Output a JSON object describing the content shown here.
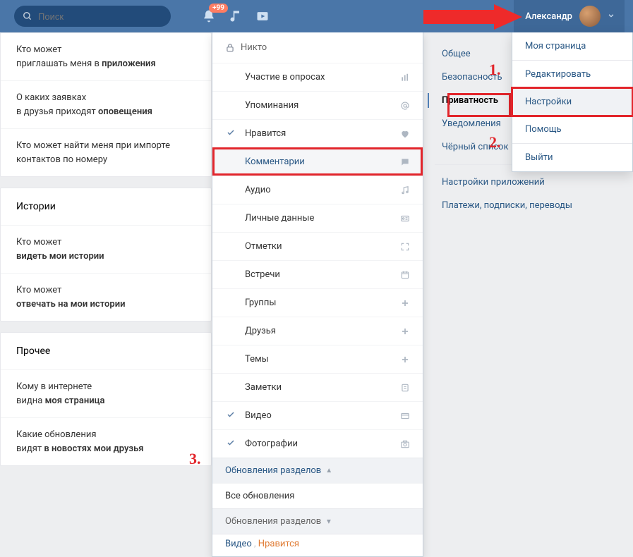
{
  "topbar": {
    "search_placeholder": "Поиск",
    "bell_badge": "+99",
    "user_name": "Александр"
  },
  "left": {
    "group1": [
      {
        "line1": "Кто может",
        "line2_a": "приглашать меня в ",
        "line2_b": "приложения"
      },
      {
        "line1": "О каких заявках",
        "line2_a": "в друзья приходят ",
        "line2_b": "оповещения"
      },
      {
        "line1": "Кто может найти меня при импорте",
        "line2_a": "контактов по номеру",
        "line2_b": ""
      }
    ],
    "group2_title": "Истории",
    "group2": [
      {
        "line1": "Кто может",
        "line2_a": "видеть мои истории",
        "bold": true
      },
      {
        "line1": "Кто может",
        "line2_a": "отвечать на мои истории",
        "bold": true
      }
    ],
    "group3_title": "Прочее",
    "group3": [
      {
        "line1": "Кому в интернете",
        "line2_a": "видна ",
        "line2_b": "моя страница"
      },
      {
        "line1": "Какие обновления",
        "line2_a": "видят ",
        "line2_b": "в новостях мои друзья"
      }
    ]
  },
  "mid": {
    "nobody": "Никто",
    "items": [
      {
        "label": "Участие в опросах",
        "icon": "bars"
      },
      {
        "label": "Упоминания",
        "icon": "at"
      },
      {
        "label": "Нравится",
        "icon": "heart",
        "checked": true
      },
      {
        "label": "Комментарии",
        "icon": "comment",
        "highlight": true
      },
      {
        "label": "Аудио",
        "icon": "music"
      },
      {
        "label": "Личные данные",
        "icon": "card"
      },
      {
        "label": "Отметки",
        "icon": "expand"
      },
      {
        "label": "Встречи",
        "icon": "calendar"
      },
      {
        "label": "Группы",
        "icon": "plus"
      },
      {
        "label": "Друзья",
        "icon": "plus"
      },
      {
        "label": "Темы",
        "icon": "plus"
      },
      {
        "label": "Заметки",
        "icon": "note"
      },
      {
        "label": "Видео",
        "icon": "video",
        "checked": true
      },
      {
        "label": "Фотографии",
        "icon": "camera",
        "checked": true
      }
    ],
    "section1": "Обновления разделов",
    "all_updates": "Все обновления",
    "section2": "Обновления разделов",
    "foot_video": "Видео",
    "foot_sep": ",",
    "foot_like": "Нравится"
  },
  "rnav": {
    "items": [
      "Общее",
      "Безопасность",
      "Приватность",
      "Уведомления",
      "Чёрный список",
      "Настройки приложений",
      "Платежи, подписки, переводы"
    ]
  },
  "acct_menu": {
    "items": [
      "Моя страница",
      "Редактировать",
      "Настройки",
      "Помощь",
      "Выйти"
    ]
  },
  "annot": {
    "n1": "1.",
    "n2": "2.",
    "n3": "3."
  }
}
